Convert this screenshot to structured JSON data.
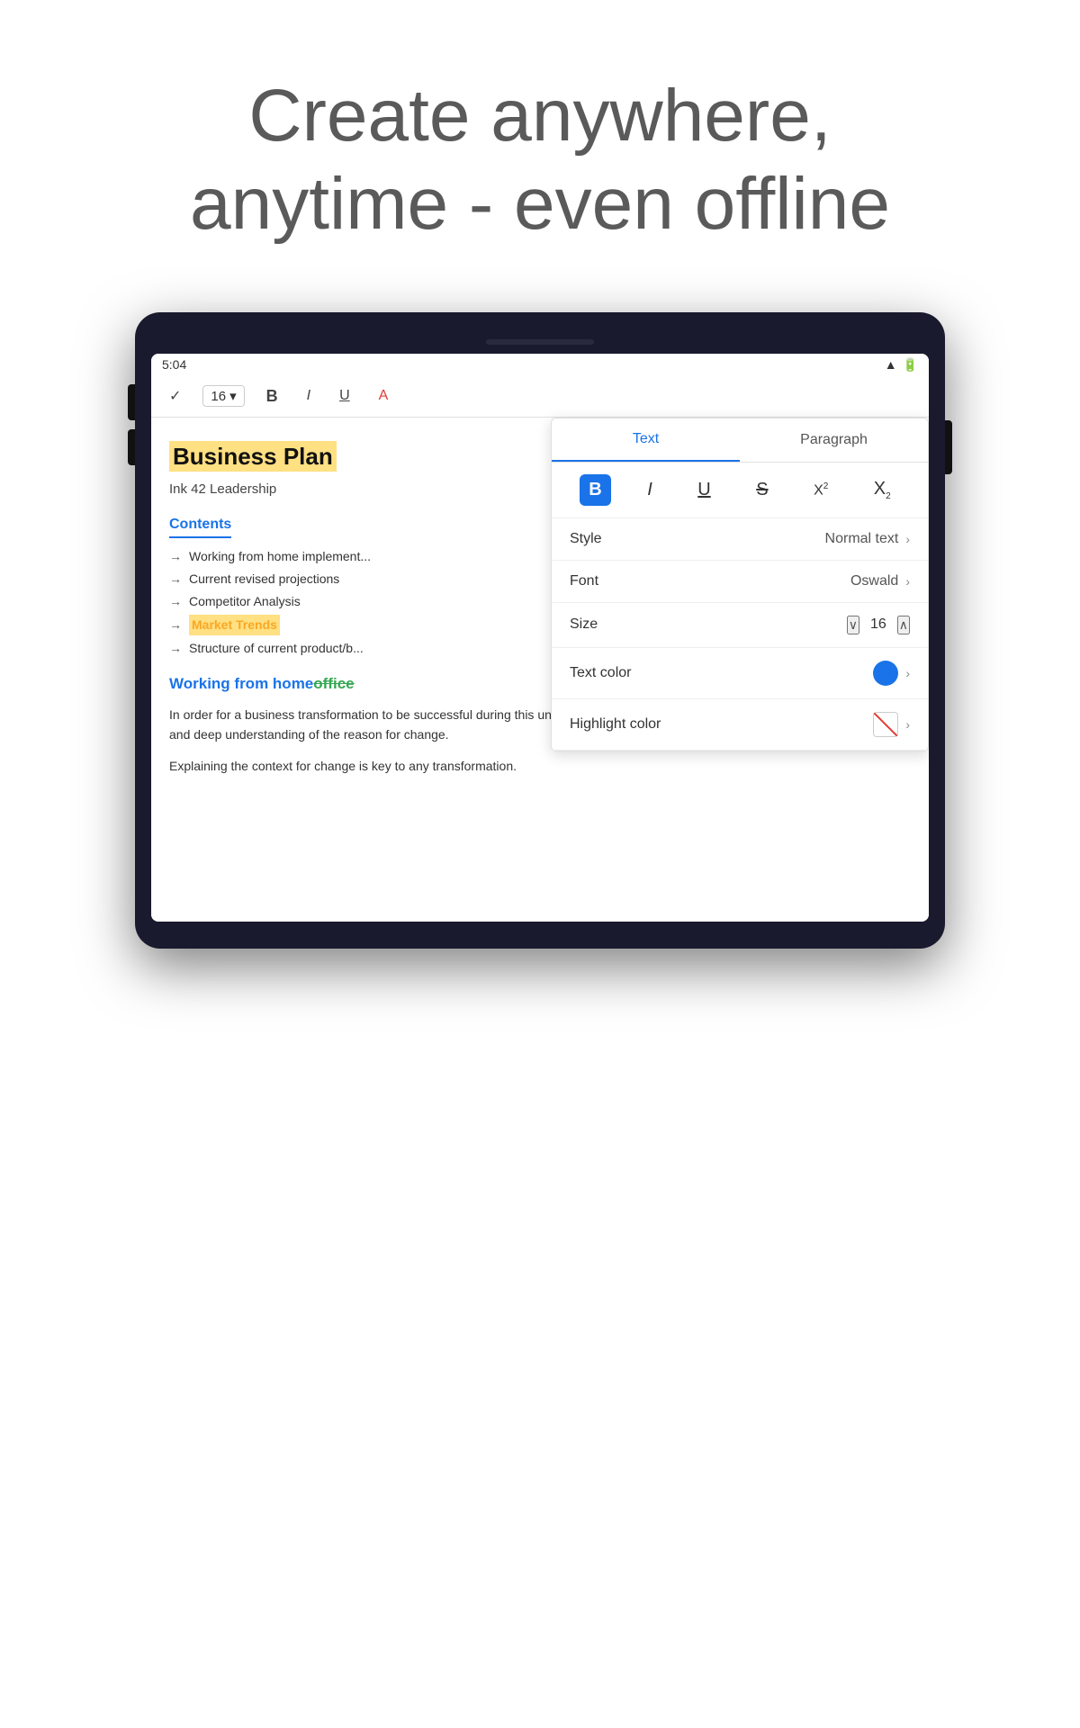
{
  "hero": {
    "line1": "Create anywhere,",
    "line2": "anytime - even offline"
  },
  "status_bar": {
    "time": "5:04",
    "icons": "▲ 🔋"
  },
  "toolbar": {
    "check": "✓",
    "size": "16",
    "size_arrow": "▾",
    "bold": "B",
    "italic": "I",
    "underline": "U",
    "font_color": "A"
  },
  "panel": {
    "tab_text": "Text",
    "tab_paragraph": "Paragraph",
    "format_buttons": [
      "B",
      "I",
      "U",
      "S",
      "X²",
      "X₂"
    ],
    "style_label": "Style",
    "style_value": "Normal text",
    "font_label": "Font",
    "font_value": "Oswald",
    "size_label": "Size",
    "size_value": "16",
    "text_color_label": "Text color",
    "highlight_color_label": "Highlight color"
  },
  "document": {
    "title": "Business Plan",
    "subtitle": "Ink 42 Leadership",
    "contents_heading": "Contents",
    "toc_items": [
      "Working from home implement...",
      "Current revised projections",
      "Competitor Analysis",
      "Market Trends",
      "Structure of current product/b..."
    ],
    "toc_highlight_index": 3,
    "section_heading_part1": "Working from home ",
    "section_heading_part2_green": "home",
    "section_heading_part3_strikethrough": "office",
    "body_text1": "In order for a business transformation to be successful during this uncertain time leaders need to manage change through a clear and deep understanding of the reason for change.",
    "body_text2": "Explaining the context for change is key to any transformation."
  }
}
